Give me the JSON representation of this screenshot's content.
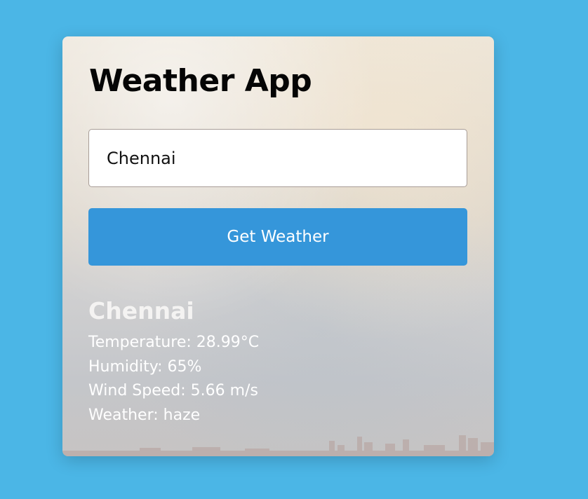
{
  "app": {
    "title": "Weather App"
  },
  "search": {
    "value": "Chennai",
    "button_label": "Get Weather"
  },
  "result": {
    "city": "Chennai",
    "temperature_line": "Temperature: 28.99°C",
    "humidity_line": "Humidity: 65%",
    "wind_line": "Wind Speed: 5.66 m/s",
    "weather_line": "Weather: haze"
  },
  "colors": {
    "page_background": "#4bb6e6",
    "button": "#3596da",
    "title_text": "#050505"
  }
}
